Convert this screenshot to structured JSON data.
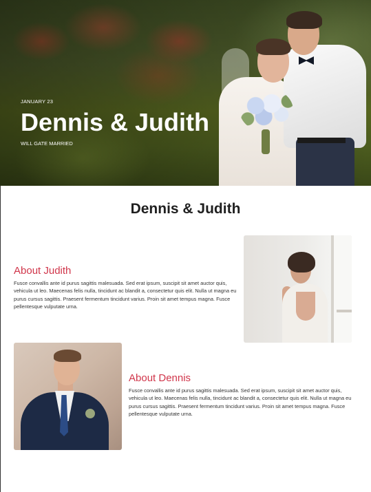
{
  "hero": {
    "date": "JANUARY 23",
    "title": "Dennis & Judith",
    "subtitle": "WILL GATE MARRIED"
  },
  "section": {
    "title": "Dennis & Judith"
  },
  "judith": {
    "heading": "About Judith",
    "text": "Fusce convallis ante id purus sagittis malesuada. Sed erat ipsum, suscipit sit amet auctor quis, vehicula ut leo. Maecenas felis nulla, tincidunt ac blandit a, consectetur quis elit. Nulla ut magna eu purus cursus sagittis. Praesent fermentum tincidunt varius. Proin sit amet tempus magna. Fusce pellentesque vulputate urna."
  },
  "dennis": {
    "heading": "About Dennis",
    "text": "Fusce convallis ante id purus sagittis malesuada. Sed erat ipsum, suscipit sit amet auctor quis, vehicula ut leo. Maecenas felis nulla, tincidunt ac blandit a, consectetur quis elit. Nulla ut magna eu purus cursus sagittis. Praesent fermentum tincidunt varius. Proin sit amet tempus magna. Fusce pellentesque vulputate urna."
  },
  "colors": {
    "accent": "#d0354a",
    "heading": "#1f1f1f",
    "body_text": "#333333"
  }
}
